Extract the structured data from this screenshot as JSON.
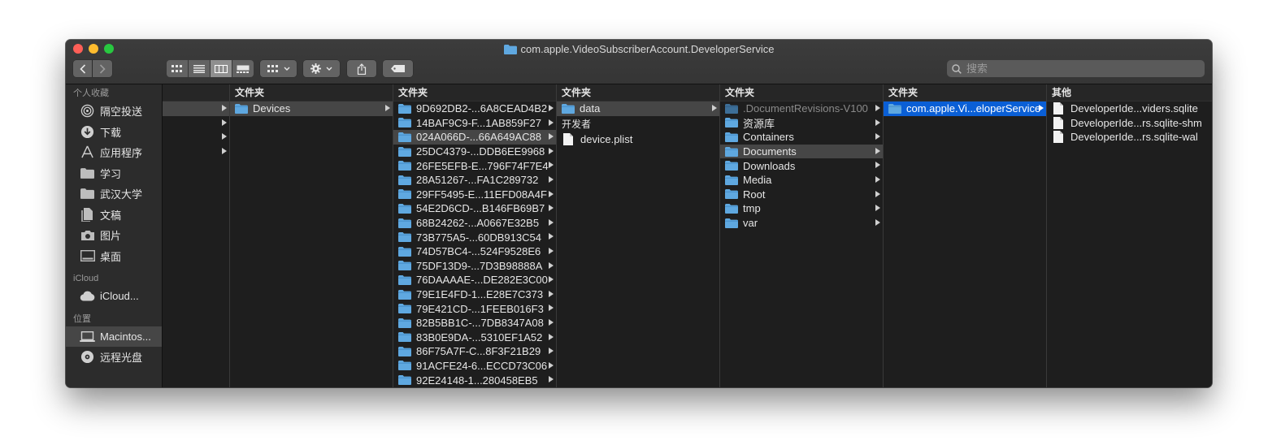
{
  "window": {
    "title": "com.apple.VideoSubscriberAccount.DeveloperService"
  },
  "toolbar": {
    "search_placeholder": "搜索"
  },
  "sidebar": {
    "favorites_header": "个人收藏",
    "favorites": [
      {
        "label": "隔空投送",
        "icon": "airdrop-icon"
      },
      {
        "label": "下载",
        "icon": "download-icon"
      },
      {
        "label": "应用程序",
        "icon": "applications-icon"
      },
      {
        "label": "学习",
        "icon": "folder-icon"
      },
      {
        "label": "武汉大学",
        "icon": "folder-icon"
      },
      {
        "label": "文稿",
        "icon": "documents-icon"
      },
      {
        "label": "图片",
        "icon": "camera-icon"
      },
      {
        "label": "桌面",
        "icon": "desktop-icon"
      }
    ],
    "icloud_header": "iCloud",
    "icloud": [
      {
        "label": "iCloud...",
        "icon": "cloud-icon"
      }
    ],
    "locations_header": "位置",
    "locations": [
      {
        "label": "Macintos...",
        "icon": "laptop-icon",
        "selected": true
      },
      {
        "label": "远程光盘",
        "icon": "disc-icon"
      }
    ]
  },
  "columns": {
    "col2": {
      "header": "文件夹",
      "items": [
        "Devices"
      ]
    },
    "col3": {
      "header": "文件夹",
      "items": [
        "9D692DB2-...6A8CEAD4B2",
        "14BAF9C9-F...1AB859F27",
        "024A066D-...66A649AC88",
        "25DC4379-...DDB6EE9968",
        "26FE5EFB-E...796F74F7E4",
        "28A51267-...FA1C289732",
        "29FF5495-E...11EFD08A4F",
        "54E2D6CD-...B146FB69B7",
        "68B24262-...A0667E32B5",
        "73B775A5-...60DB913C54",
        "74D57BC4-...524F9528E6",
        "75DF13D9-...7D3B98888A",
        "76DAAAAE-...DE282E3C00",
        "79E1E4FD-1...E28E7C373",
        "79E421CD-...1FEEB016F3",
        "82B5BB1C-...7DB8347A08",
        "83B0E9DA-...5310EF1A52",
        "86F75A7F-C...8F3F21B29",
        "91ACFE24-6...ECCD73C06",
        "92E24148-1...280458EB5"
      ],
      "selected_index": 2
    },
    "col4": {
      "header": "文件夹",
      "items": [
        "data"
      ],
      "dev_header": "开发者",
      "dev_items": [
        "device.plist"
      ]
    },
    "col5": {
      "header": "文件夹",
      "items": [
        ".DocumentRevisions-V100",
        "资源库",
        "Containers",
        "Documents",
        "Downloads",
        "Media",
        "Root",
        "tmp",
        "var"
      ],
      "selected_index": 3
    },
    "col6": {
      "header": "文件夹",
      "items": [
        "com.apple.Vi...eloperService"
      ]
    },
    "col7": {
      "header": "其他",
      "items": [
        "DeveloperIde...viders.sqlite",
        "DeveloperIde...rs.sqlite-shm",
        "DeveloperIde...rs.sqlite-wal"
      ]
    }
  },
  "colors": {
    "folder": "#5fa8e0",
    "selection_blue": "#0a5fd6",
    "selection_gray": "#464646"
  }
}
